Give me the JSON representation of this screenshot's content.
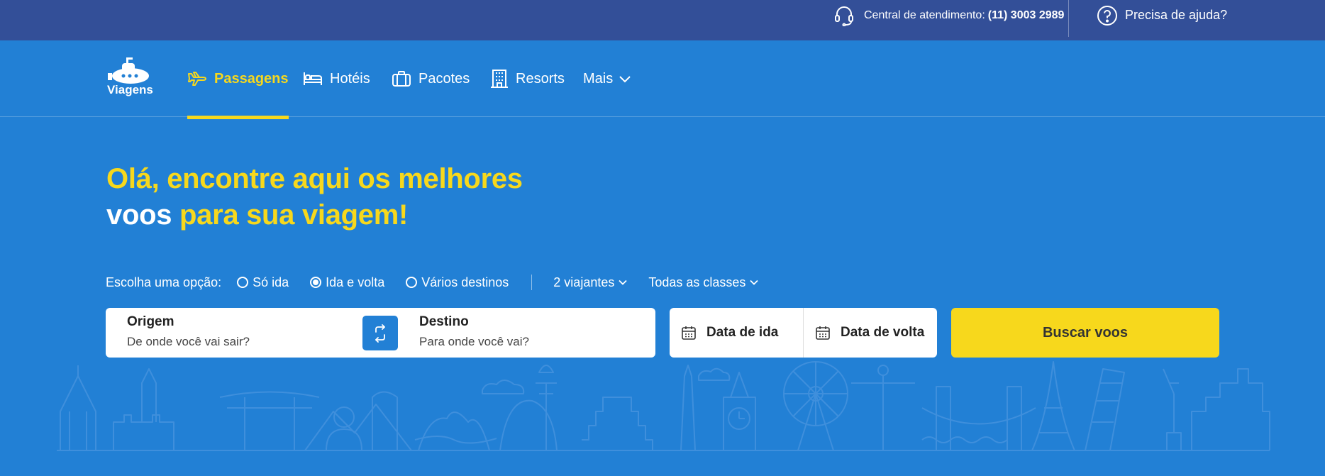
{
  "topbar": {
    "support_label": "Central de atendimento:",
    "support_phone": "(11) 3003 2989",
    "help_label": "Precisa de ajuda?"
  },
  "brand": {
    "logo_text": "Viagens"
  },
  "nav": {
    "items": [
      {
        "label": "Passagens",
        "icon": "airplane-icon",
        "active": true
      },
      {
        "label": "Hotéis",
        "icon": "bed-icon",
        "active": false
      },
      {
        "label": "Pacotes",
        "icon": "suitcase-icon",
        "active": false
      },
      {
        "label": "Resorts",
        "icon": "building-icon",
        "active": false
      },
      {
        "label": "Mais",
        "icon": "chevron-down-icon",
        "active": false
      }
    ]
  },
  "headline": {
    "line1": "Olá, encontre aqui os melhores",
    "line2_white": "voos",
    "line2_yellow": "para sua viagem!"
  },
  "options": {
    "label": "Escolha uma opção:",
    "trip_types": [
      {
        "label": "Só ida",
        "checked": false
      },
      {
        "label": "Ida e volta",
        "checked": true
      },
      {
        "label": "Vários destinos",
        "checked": false
      }
    ],
    "travelers": "2 viajantes",
    "cabin_class": "Todas as classes"
  },
  "search": {
    "origin_title": "Origem",
    "origin_placeholder": "De onde você vai sair?",
    "destination_title": "Destino",
    "destination_placeholder": "Para onde você vai?",
    "departure_label": "Data de ida",
    "return_label": "Data de volta",
    "submit_label": "Buscar voos"
  },
  "colors": {
    "topbar_bg": "#334f98",
    "main_bg": "#2280d5",
    "accent_yellow": "#f7d81c"
  }
}
